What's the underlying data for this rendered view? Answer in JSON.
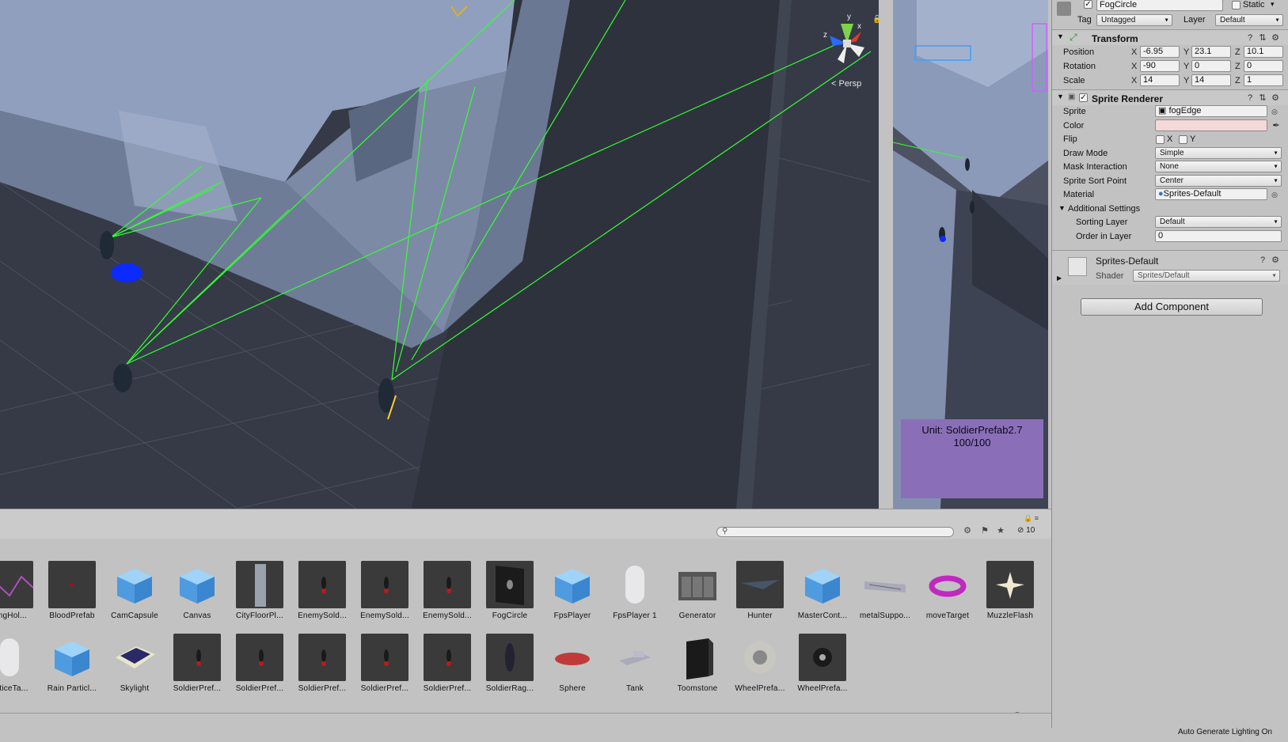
{
  "scene": {
    "persp_label": "< Persp",
    "gizmo_axes": {
      "x": "x",
      "y": "y",
      "z": "z"
    }
  },
  "game": {
    "unit_name": "Unit: SoldierPrefab2.7",
    "unit_health": "100/100"
  },
  "project": {
    "search_placeholder": "",
    "hidden_count": "10",
    "assets_row1": [
      {
        "label": "kingHol...",
        "icon": "truss-thumb"
      },
      {
        "label": "BloodPrefab",
        "icon": "blood-thumb"
      },
      {
        "label": "CamCapsule",
        "icon": "cube-thumb"
      },
      {
        "label": "Canvas",
        "icon": "cube-thumb"
      },
      {
        "label": "CityFloorPl...",
        "icon": "building-thumb"
      },
      {
        "label": "EnemySold...",
        "icon": "soldier-thumb"
      },
      {
        "label": "EnemySold...",
        "icon": "soldier-thumb"
      },
      {
        "label": "EnemySold...",
        "icon": "soldier-thumb"
      },
      {
        "label": "FogCircle",
        "icon": "fog-thumb"
      },
      {
        "label": "FpsPlayer",
        "icon": "cube-thumb"
      },
      {
        "label": "FpsPlayer 1",
        "icon": "capsule-thumb"
      },
      {
        "label": "Generator",
        "icon": "generator-thumb"
      },
      {
        "label": "Hunter",
        "icon": "jet-thumb"
      },
      {
        "label": "MasterCont...",
        "icon": "cube-thumb"
      },
      {
        "label": "metalSuppo...",
        "icon": "beam-thumb"
      },
      {
        "label": "moveTarget",
        "icon": "torus-thumb"
      },
      {
        "label": "MuzzleFlash",
        "icon": "flash-thumb"
      }
    ],
    "assets_row2": [
      {
        "label": "acticeTa...",
        "icon": "capsule-thumb"
      },
      {
        "label": "Rain Particl...",
        "icon": "cube-thumb"
      },
      {
        "label": "Skylight",
        "icon": "skylight-thumb"
      },
      {
        "label": "SoldierPref...",
        "icon": "soldier-thumb"
      },
      {
        "label": "SoldierPref...",
        "icon": "soldier-thumb"
      },
      {
        "label": "SoldierPref...",
        "icon": "soldier-thumb"
      },
      {
        "label": "SoldierPref...",
        "icon": "soldier-thumb"
      },
      {
        "label": "SoldierPref...",
        "icon": "soldier-thumb"
      },
      {
        "label": "SoldierRag...",
        "icon": "ragdoll-thumb"
      },
      {
        "label": "Sphere",
        "icon": "disc-thumb"
      },
      {
        "label": "Tank",
        "icon": "tank-thumb"
      },
      {
        "label": "Toomstone",
        "icon": "stone-thumb"
      },
      {
        "label": "WheelPrefa...",
        "icon": "wheel-thumb"
      },
      {
        "label": "WheelPrefa...",
        "icon": "wheel-dark-thumb"
      }
    ],
    "status_text": "Auto Generate Lighting On"
  },
  "inspector": {
    "object_name": "FogCircle",
    "static_label": "Static",
    "tag_label": "Tag",
    "tag_value": "Untagged",
    "layer_label": "Layer",
    "layer_value": "Default",
    "transform": {
      "title": "Transform",
      "position_label": "Position",
      "rotation_label": "Rotation",
      "scale_label": "Scale",
      "x_label": "X",
      "y_label": "Y",
      "z_label": "Z",
      "position": {
        "x": "-6.95",
        "y": "23.1",
        "z": "10.1"
      },
      "rotation": {
        "x": "-90",
        "y": "0",
        "z": "0"
      },
      "scale": {
        "x": "14",
        "y": "14",
        "z": "1"
      }
    },
    "sprite_renderer": {
      "title": "Sprite Renderer",
      "sprite_label": "Sprite",
      "sprite_value": "fogEdge",
      "color_label": "Color",
      "color_value": "#f5d8d8",
      "flip_label": "Flip",
      "flip_x": "X",
      "flip_y": "Y",
      "draw_mode_label": "Draw Mode",
      "draw_mode_value": "Simple",
      "mask_label": "Mask Interaction",
      "mask_value": "None",
      "sort_point_label": "Sprite Sort Point",
      "sort_point_value": "Center",
      "material_label": "Material",
      "material_value": "Sprites-Default",
      "additional_label": "Additional Settings",
      "sorting_layer_label": "Sorting Layer",
      "sorting_layer_value": "Default",
      "order_label": "Order in Layer",
      "order_value": "0"
    },
    "material": {
      "name": "Sprites-Default",
      "shader_label": "Shader",
      "shader_value": "Sprites/Default"
    },
    "add_component": "Add Component"
  },
  "colors": {
    "ray_green": "#33ff33",
    "unit_panel": "#8a6fb8",
    "selection_blue": "#0a2aff"
  }
}
